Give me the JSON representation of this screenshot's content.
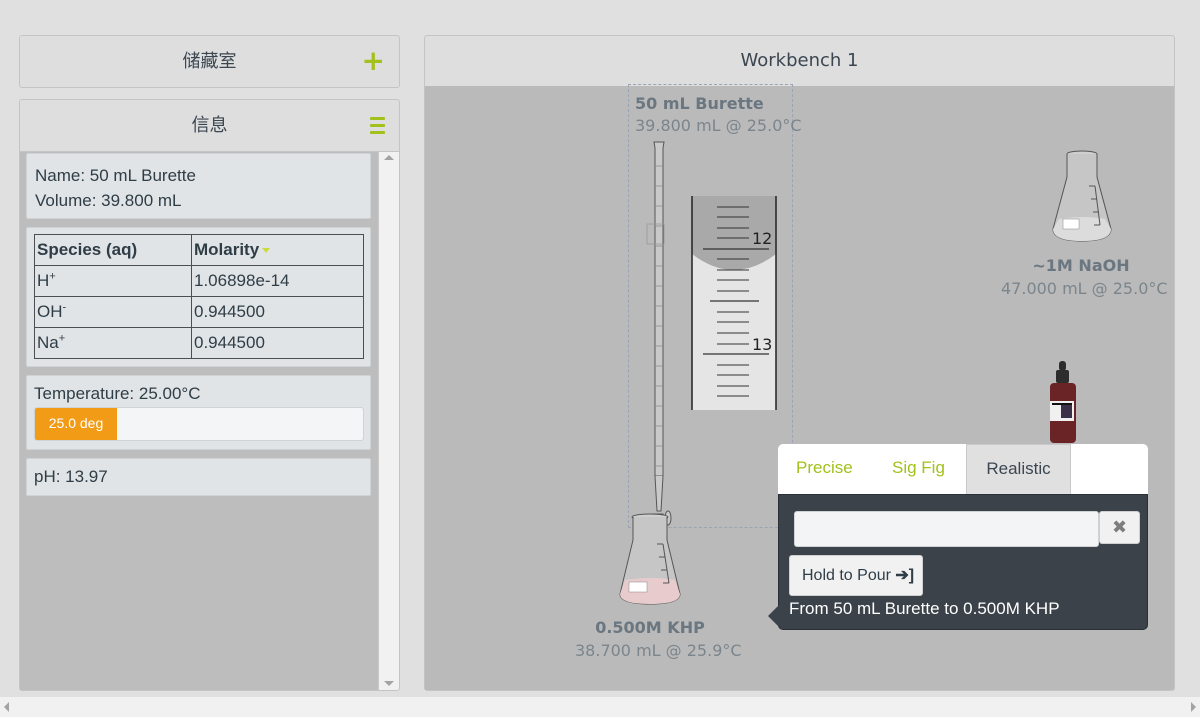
{
  "storage": {
    "title": "储藏室",
    "add_icon": "plus-icon"
  },
  "info": {
    "title": "信息",
    "menu_icon": "hamburger-icon",
    "name_line": "Name: 50 mL Burette",
    "volume_line": "Volume: 39.800 mL",
    "species_table": {
      "headers": [
        "Species (aq)",
        "Molarity"
      ],
      "sort_column": "Molarity",
      "rows": [
        {
          "species": "H",
          "charge": "+",
          "molarity": "1.06898e-14"
        },
        {
          "species": "OH",
          "charge": "-",
          "molarity": "0.944500"
        },
        {
          "species": "Na",
          "charge": "+",
          "molarity": "0.944500"
        }
      ]
    },
    "temperature_line": "Temperature: 25.00°C",
    "temperature_bar": {
      "label": "25.0 deg",
      "fill_fraction": 0.25,
      "color": "#f29b16"
    },
    "ph_line": "pH: 13.97"
  },
  "workbench": {
    "title": "Workbench 1",
    "items": {
      "burette": {
        "name": "50 mL Burette",
        "status": "39.800 mL @ 25.0°C"
      },
      "khp_flask": {
        "name": "0.500M KHP",
        "status": "38.700 mL @ 25.9°C"
      },
      "naoh_flask": {
        "name": "~1M NaOH",
        "status": "47.000 mL @ 25.0°C"
      },
      "indicator_bottle": {
        "icon": "dropper-bottle-icon"
      }
    },
    "burette_zoom": {
      "tick_labels": [
        "12",
        "13"
      ]
    }
  },
  "pour_popover": {
    "tabs": [
      "Precise",
      "Sig Fig",
      "Realistic"
    ],
    "active_tab": "Realistic",
    "amount_value": "",
    "clear_icon": "close-icon",
    "pour_button": "Hold to Pour",
    "pour_icon": "sign-in-icon",
    "description": "From 50 mL Burette to 0.500M KHP"
  },
  "colors": {
    "accent": "#a2c11c",
    "khp_solution": "#e8cbcc",
    "popover_bg": "#3b4249"
  }
}
